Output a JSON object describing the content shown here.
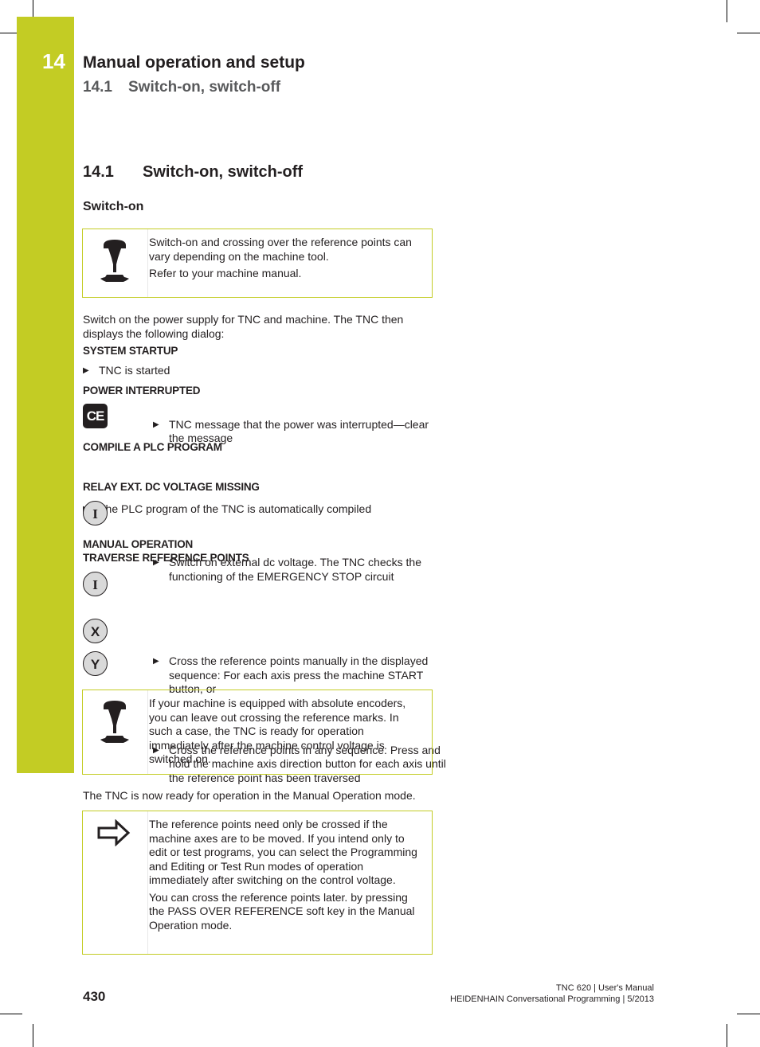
{
  "header": {
    "chapter_number": "14",
    "chapter_title": "Manual operation and setup",
    "section_number": "14.1",
    "section_title": "Switch-on, switch-off"
  },
  "colors": {
    "accent": "#c3cc24",
    "text": "#231f20",
    "subtitle": "#58595b"
  },
  "section": {
    "number": "14.1",
    "title": "Switch-on, switch-off",
    "subheading": "Switch-on"
  },
  "note1": {
    "icon": "machine-dependent-icon",
    "lines": [
      "Switch-on and crossing over the reference points can vary depending on the machine tool.",
      "Refer to your machine manual."
    ]
  },
  "intro": "Switch on the power supply for TNC and machine. The TNC then displays the following dialog:",
  "steps": [
    {
      "dialog": "SYSTEM STARTUP",
      "bullets": [
        "TNC is started"
      ]
    },
    {
      "dialog": "POWER INTERRUPTED",
      "key": "CE",
      "bullets": [
        "TNC message that the power was interrupted—clear the message"
      ]
    },
    {
      "dialog": "COMPILE A PLC PROGRAM",
      "bullets": [
        "The PLC program of the TNC is automatically compiled"
      ]
    },
    {
      "dialog": "RELAY EXT. DC VOLTAGE MISSING",
      "key": "I",
      "bullets": [
        "Switch on external dc voltage. The TNC checks the functioning of the EMERGENCY STOP circuit"
      ]
    },
    {
      "dialog_lines": [
        "MANUAL OPERATION",
        "TRAVERSE REFERENCE POINTS"
      ],
      "keys": [
        "I",
        "X",
        "Y"
      ],
      "bullets": [
        "Cross the reference points manually in the displayed sequence: For each axis press the machine START button, or",
        "Cross the reference points in any sequence: Press and hold the machine axis direction button for each axis until the reference point has been traversed"
      ]
    }
  ],
  "note2": {
    "icon": "machine-dependent-icon",
    "text": "If your machine is equipped with absolute encoders, you can leave out crossing the reference marks. In such a case, the TNC is ready for operation immediately after the machine control voltage is switched on."
  },
  "ready_text": "The TNC is now ready for operation in the Manual Operation mode.",
  "note3": {
    "icon": "arrow-right-icon",
    "lines": [
      "The reference points need only be crossed if the machine axes are to be moved. If you intend only to edit or test programs, you can select the Programming and Editing or Test Run modes of operation immediately after switching on the control voltage.",
      "You can cross the reference points later. by pressing the PASS OVER REFERENCE soft key in the Manual Operation mode."
    ]
  },
  "footer": {
    "page_number": "430",
    "line1": "TNC 620 | User's Manual",
    "line2": "HEIDENHAIN Conversational Programming | 5/2013"
  }
}
